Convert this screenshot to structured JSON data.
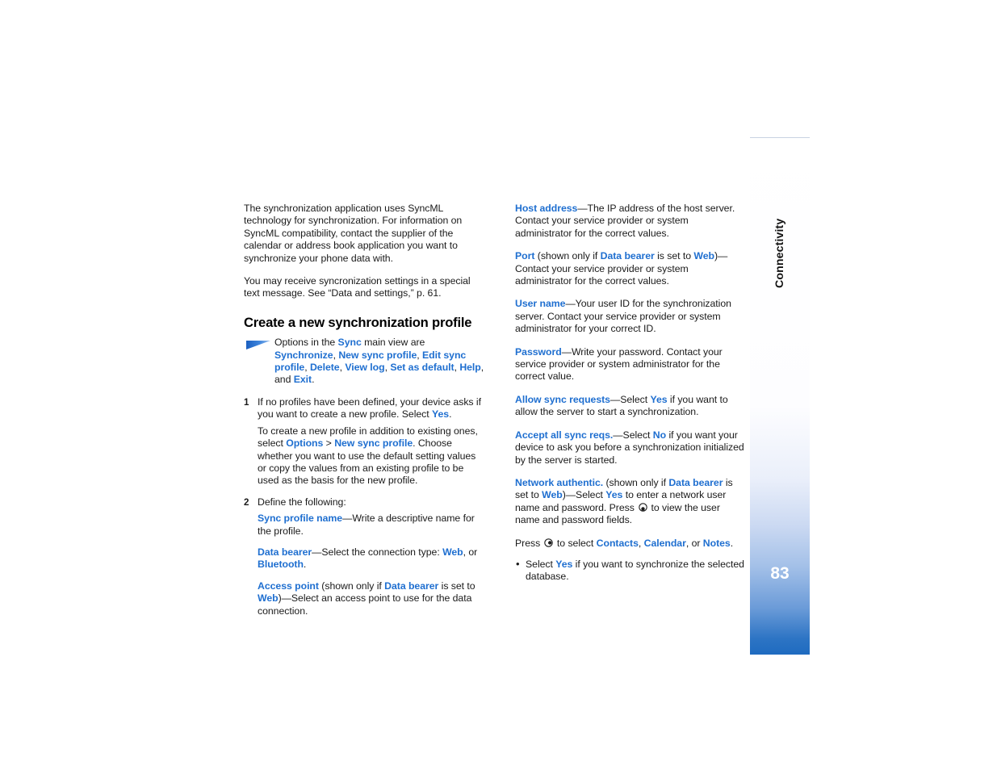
{
  "document": {
    "type": "user-guide-page",
    "page_number": "83",
    "section_tab_label": "Connectivity",
    "accent_color": "#1f6fd0",
    "tab_gradient_end_color": "#1f6bc0"
  },
  "left_column": {
    "intro_paragraph_1": {
      "seg1": "The synchronization application uses SyncML technology for synchronization. For information on SyncML compatibility, contact the supplier of the calendar or address book application you want to synchronize your phone data with."
    },
    "intro_paragraph_2": {
      "seg1": "You may receive syncronization settings in a special text message. See “Data and settings,” p. 61."
    },
    "heading": "Create a new synchronization profile",
    "tip": {
      "icon": "tip-arrow-icon",
      "seg1": "Options in the ",
      "ui1": "Sync",
      "seg2": " main view are ",
      "ui2": "Synchronize",
      "seg3": ", ",
      "ui3": "New sync profile",
      "seg4": ", ",
      "ui4": "Edit sync profile",
      "seg5": ", ",
      "ui5": "Delete",
      "seg6": ", ",
      "ui6": "View log",
      "seg7": ", ",
      "ui7": "Set as default",
      "seg8": ", ",
      "ui8": "Help",
      "seg9": ", and ",
      "ui9": "Exit",
      "seg10": "."
    },
    "step1": {
      "num": "1",
      "seg1": "If no profiles have been defined, your device asks if you want to create a new profile. Select ",
      "ui1": "Yes",
      "seg2": "."
    },
    "step1_sub": {
      "seg1": "To create a new profile in addition to existing ones, select ",
      "ui1": "Options",
      "seg2": " > ",
      "ui2": "New sync profile",
      "seg3": ". Choose whether you want to use the default setting values or copy the values from an existing profile to be used as the basis for the new profile."
    },
    "step2": {
      "num": "2",
      "seg1": "Define the following:"
    },
    "settings": [
      {
        "ui1": "Sync profile name",
        "seg1": "—Write a descriptive name for the profile."
      },
      {
        "ui1": "Data bearer",
        "seg1": "—Select the connection type: ",
        "ui2": "Web",
        "seg2": ", or ",
        "ui3": "Bluetooth",
        "seg3": "."
      },
      {
        "ui1": "Access point",
        "seg1": " (shown only if ",
        "ui2": "Data bearer",
        "seg2": " is set to ",
        "ui3": "Web",
        "seg3": ")—Select an access point to use for the data connection."
      }
    ]
  },
  "right_column": {
    "settings": [
      {
        "ui1": "Host address",
        "seg1": "—The IP address of the host server. Contact your service provider or system administrator for the correct values."
      },
      {
        "ui1": "Port",
        "seg1": " (shown only if ",
        "ui2": "Data bearer",
        "seg2": " is set to ",
        "ui3": "Web",
        "seg3": ")—Contact your service provider or system administrator for the correct values."
      },
      {
        "ui1": "User name",
        "seg1": "—Your user ID for the synchronization server. Contact your service provider or system administrator for your correct ID."
      },
      {
        "ui1": "Password",
        "seg1": "—Write your password. Contact your service provider or system administrator for the correct value."
      },
      {
        "ui1": "Allow sync requests",
        "seg1": "—Select ",
        "ui2": "Yes",
        "seg2": " if you want to allow the server to start a synchronization."
      },
      {
        "ui1": "Accept all sync reqs.",
        "seg1": "—Select ",
        "ui2": "No",
        "seg2": " if you want your device to ask you before a synchronization initialized by the server is started."
      }
    ],
    "network_authentic": {
      "ui1": "Network authentic.",
      "seg1": " (shown only if ",
      "ui2": "Data bearer",
      "seg2": " is set to ",
      "ui3": "Web",
      "seg3": ")—Select ",
      "ui4": "Yes",
      "seg4": " to enter a network user name and password. Press ",
      "icon": "scroll-down-key-icon",
      "seg5": " to view the user name and password fields."
    },
    "press_to_select": {
      "seg1": "Press ",
      "icon": "scroll-right-key-icon",
      "seg2": " to select ",
      "ui1": "Contacts",
      "seg3": ", ",
      "ui2": "Calendar",
      "seg4": ", or ",
      "ui3": "Notes",
      "seg5": "."
    },
    "bullet": {
      "marker": "•",
      "seg1": "Select ",
      "ui1": "Yes",
      "seg2": " if you want to synchronize the selected database."
    }
  }
}
